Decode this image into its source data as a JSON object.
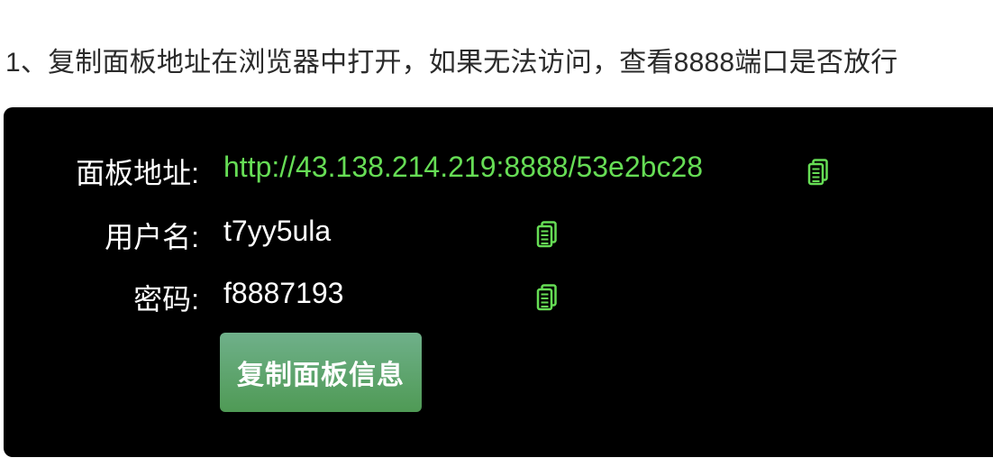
{
  "instruction": {
    "text": "1、复制面板地址在浏览器中打开，如果无法访问，查看8888端口是否放行"
  },
  "panel": {
    "address": {
      "label": "面板地址:",
      "value": "http://43.138.214.219:8888/53e2bc28"
    },
    "username": {
      "label": "用户名:",
      "value": "t7yy5ula"
    },
    "password": {
      "label": "密码:",
      "value": "f8887193"
    },
    "copy_button_label": "复制面板信息"
  },
  "colors": {
    "panel_background": "#000000",
    "link_green": "#66dd55",
    "icon_green": "#66dd55",
    "button_green": "#5aa463"
  },
  "icons": {
    "copy": "copy-icon"
  }
}
